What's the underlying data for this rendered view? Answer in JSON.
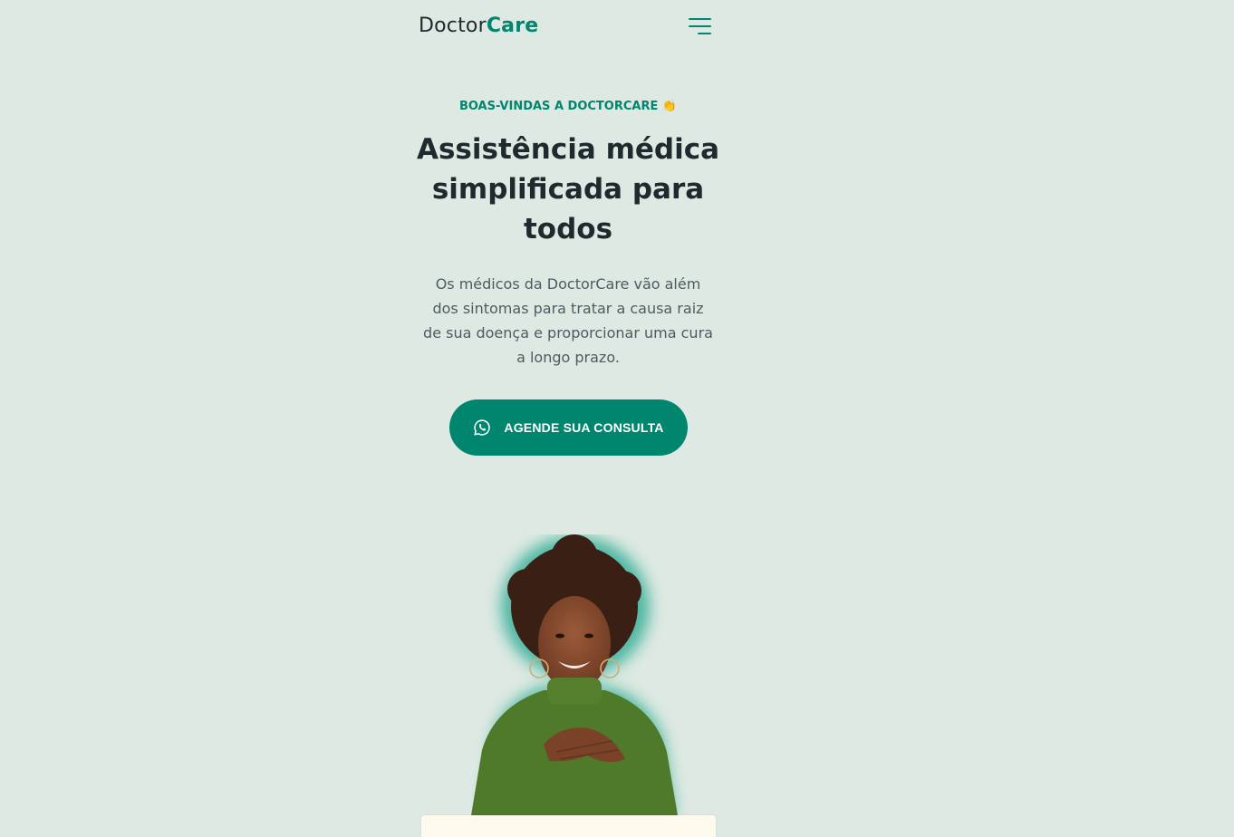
{
  "header": {
    "logo_prefix": "Doctor",
    "logo_accent": "Care",
    "menu_icon": "menu-icon"
  },
  "hero": {
    "kicker": "BOAS-VINDAS A DOCTORCARE 👏",
    "title": "Assistência médica simplificada para todos",
    "description": "Os médicos da DoctorCare vão além dos sintomas para tratar a causa raiz de sua doença e proporcionar uma cura a longo prazo.",
    "cta_label": "AGENDE SUA CONSULTA",
    "cta_icon": "whatsapp-icon"
  },
  "colors": {
    "background": "#dde9e2",
    "brand": "#00856f",
    "heading": "#1f2a2e",
    "body_text": "#4d5c60",
    "card": "#fffaee"
  }
}
